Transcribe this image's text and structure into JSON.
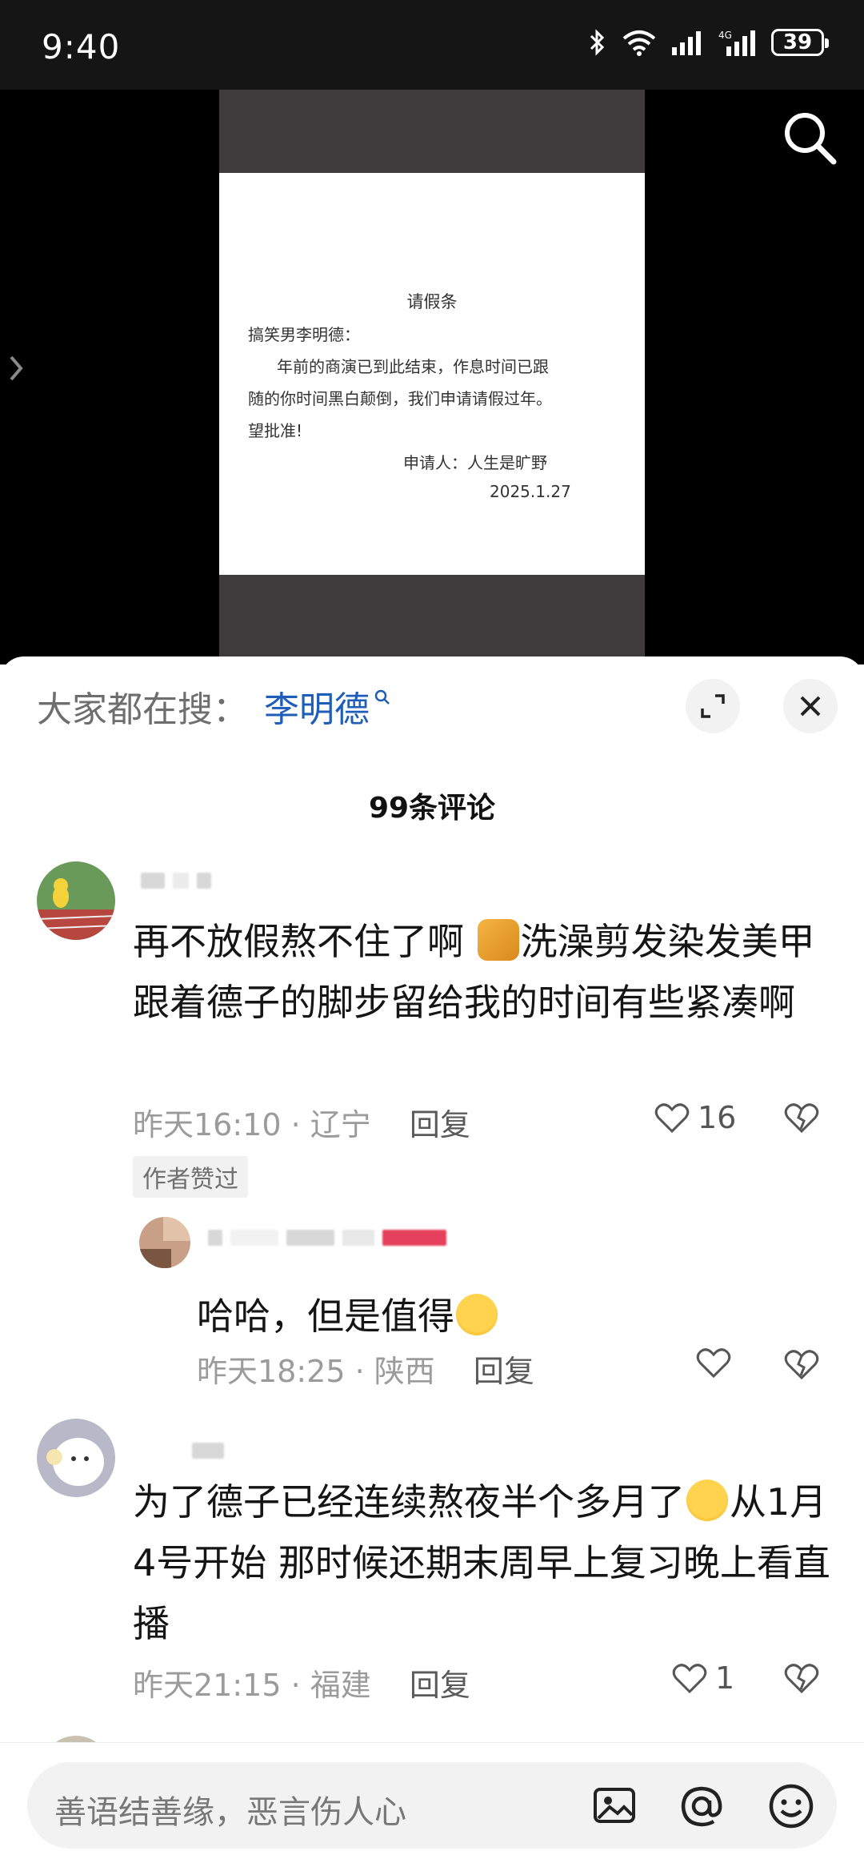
{
  "status_bar": {
    "time": "9:40",
    "battery": "39"
  },
  "video": {
    "doc_title": "请假条",
    "doc_salutation": "搞笑男李明德：",
    "doc_body_1": "年前的商演已到此结束，作息时间已跟",
    "doc_body_2": "随的你时间黑白颠倒，我们申请请假过年。",
    "doc_body_3": "望批准!",
    "doc_signature": "申请人：人生是旷野",
    "doc_date": "2025.1.27"
  },
  "sheet": {
    "hot_search_label": "大家都在搜：",
    "hot_search_keyword": "李明德",
    "comment_count": "99条评论"
  },
  "comments": [
    {
      "text_before": "再不放假熬不住了啊 ",
      "text_after": "洗澡剪发染发美甲跟着德子的脚步留给我的时间有些紧凑啊",
      "time": "昨天16:10 · 辽宁",
      "reply": "回复",
      "likes": "16",
      "badge": "作者赞过"
    },
    {
      "text": "哈哈，但是值得",
      "time": "昨天18:25 · 陕西",
      "reply": "回复"
    },
    {
      "text_before": "为了德子已经连续熬夜半个多月了",
      "text_after": "从1月4号开始 那时候还期末周早上复习晚上看直播",
      "time": "昨天21:15 · 福建",
      "reply": "回复",
      "likes": "1"
    }
  ],
  "input": {
    "placeholder": "善语结善缘，恶言伤人心"
  },
  "colors": {
    "accent": "#1e5eb8",
    "status_bar": "#151515"
  }
}
